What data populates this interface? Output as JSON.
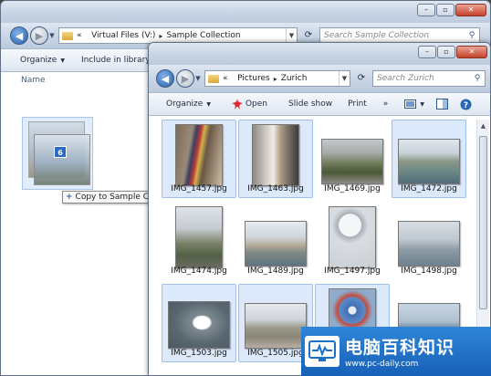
{
  "outer_window": {
    "address": {
      "overflow": "«",
      "crumbs": [
        "Virtual Files (V:)",
        "Sample Collection"
      ]
    },
    "search_placeholder": "Search Sample Collection",
    "toolbar": {
      "organize": "Organize",
      "include": "Include in library"
    },
    "column_header": "Name",
    "caption": {
      "min": "–",
      "max": "▫",
      "close": "✕"
    }
  },
  "drag": {
    "count": "6",
    "tooltip_prefix": "+",
    "tooltip": "Copy to Sample Collection"
  },
  "inner_window": {
    "address": {
      "overflow": "«",
      "crumbs": [
        "Pictures",
        "Zurich"
      ]
    },
    "search_placeholder": "Search Zurich",
    "toolbar": {
      "organize": "Organize",
      "open": "Open",
      "slideshow": "Slide show",
      "print": "Print",
      "more": "»"
    },
    "caption": {
      "min": "–",
      "max": "▫",
      "close": "✕"
    },
    "files": [
      {
        "name": "IMG_1457.jpg",
        "selected": true
      },
      {
        "name": "IMG_1463.jpg",
        "selected": true
      },
      {
        "name": "IMG_1469.jpg",
        "selected": false
      },
      {
        "name": "IMG_1472.jpg",
        "selected": true
      },
      {
        "name": "IMG_1474.jpg",
        "selected": false
      },
      {
        "name": "IMG_1489.jpg",
        "selected": false
      },
      {
        "name": "IMG_1497.jpg",
        "selected": false
      },
      {
        "name": "IMG_1498.jpg",
        "selected": false
      },
      {
        "name": "IMG_1503.jpg",
        "selected": true
      },
      {
        "name": "IMG_1505.jpg",
        "selected": true
      },
      {
        "name": "",
        "selected": true
      },
      {
        "name": "",
        "selected": false
      }
    ]
  },
  "watermark": {
    "title": "电脑百科知识",
    "url": "www.pc-daily.com"
  },
  "colors": {
    "selection": "#dbe9fb",
    "accent": "#2b62b8",
    "watermark_bg": "#1f6fc8"
  },
  "icons": [
    "back-arrow-icon",
    "forward-arrow-icon",
    "folder-icon",
    "refresh-icon",
    "search-icon",
    "open-icon",
    "view-icon",
    "preview-pane-icon",
    "help-icon",
    "copy-plus-icon"
  ]
}
